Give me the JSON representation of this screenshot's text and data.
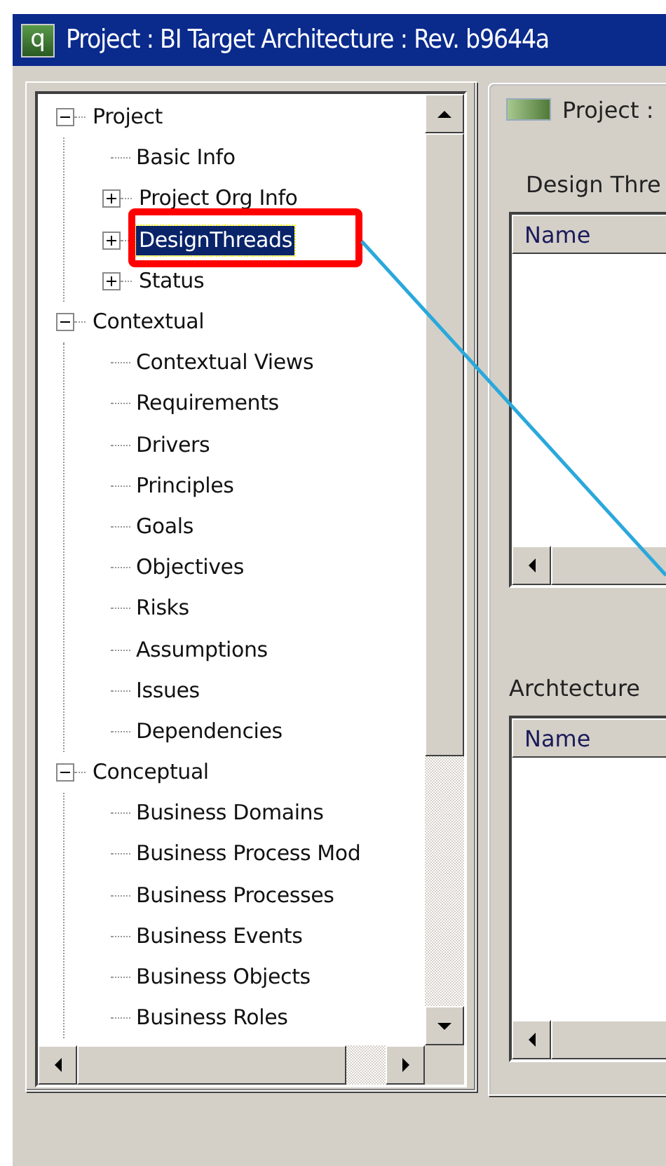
{
  "window": {
    "title": "Project : BI Target Architecture : Rev. b9644a",
    "icon_text": "q"
  },
  "tree": {
    "items": [
      {
        "label": "Project",
        "selected": false,
        "expanded": true,
        "children": [
          {
            "label": "Basic Info",
            "selected": false
          },
          {
            "label": "Project Org Info",
            "selected": false,
            "expanded": false
          },
          {
            "label": "DesignThreads",
            "selected": true,
            "expanded": false
          },
          {
            "label": "Status",
            "selected": false,
            "expanded": false
          }
        ]
      },
      {
        "label": "Contextual",
        "selected": false,
        "expanded": true,
        "children": [
          {
            "label": "Contextual Views",
            "selected": false
          },
          {
            "label": "Requirements",
            "selected": false
          },
          {
            "label": "Drivers",
            "selected": false
          },
          {
            "label": "Principles",
            "selected": false
          },
          {
            "label": "Goals",
            "selected": false
          },
          {
            "label": "Objectives",
            "selected": false
          },
          {
            "label": "Risks",
            "selected": false
          },
          {
            "label": "Assumptions",
            "selected": false
          },
          {
            "label": "Issues",
            "selected": false
          },
          {
            "label": "Dependencies",
            "selected": false
          }
        ]
      },
      {
        "label": "Conceptual",
        "selected": false,
        "expanded": true,
        "children": [
          {
            "label": "Business Domains",
            "selected": false
          },
          {
            "label": "Business Process Mod",
            "selected": false
          },
          {
            "label": "Business Processes",
            "selected": false
          },
          {
            "label": "Business Events",
            "selected": false
          },
          {
            "label": "Business Objects",
            "selected": false
          },
          {
            "label": "Business Roles",
            "selected": false
          }
        ]
      }
    ]
  },
  "detail": {
    "header": "Project :",
    "sections": [
      {
        "label": "Design Thre",
        "columns": [
          "Name"
        ]
      },
      {
        "label": "Archtecture",
        "columns": [
          "Name"
        ]
      }
    ]
  }
}
